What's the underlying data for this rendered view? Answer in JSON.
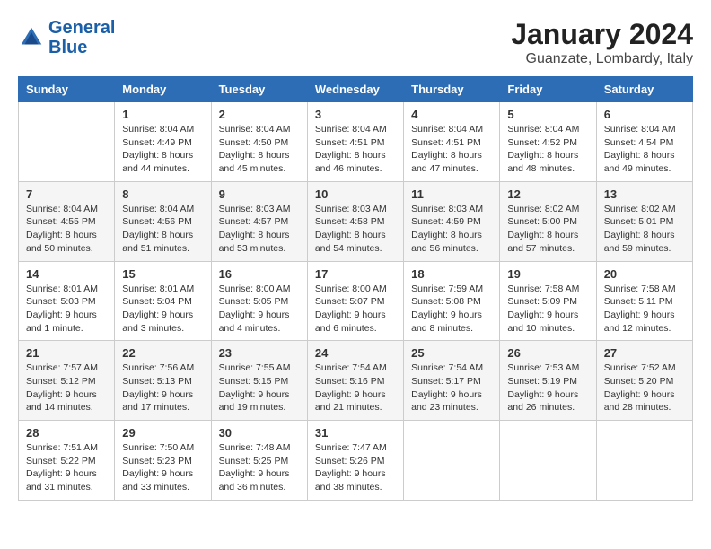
{
  "logo": {
    "line1": "General",
    "line2": "Blue"
  },
  "title": "January 2024",
  "subtitle": "Guanzate, Lombardy, Italy",
  "days_of_week": [
    "Sunday",
    "Monday",
    "Tuesday",
    "Wednesday",
    "Thursday",
    "Friday",
    "Saturday"
  ],
  "weeks": [
    [
      {
        "day": "",
        "info": ""
      },
      {
        "day": "1",
        "info": "Sunrise: 8:04 AM\nSunset: 4:49 PM\nDaylight: 8 hours\nand 44 minutes."
      },
      {
        "day": "2",
        "info": "Sunrise: 8:04 AM\nSunset: 4:50 PM\nDaylight: 8 hours\nand 45 minutes."
      },
      {
        "day": "3",
        "info": "Sunrise: 8:04 AM\nSunset: 4:51 PM\nDaylight: 8 hours\nand 46 minutes."
      },
      {
        "day": "4",
        "info": "Sunrise: 8:04 AM\nSunset: 4:51 PM\nDaylight: 8 hours\nand 47 minutes."
      },
      {
        "day": "5",
        "info": "Sunrise: 8:04 AM\nSunset: 4:52 PM\nDaylight: 8 hours\nand 48 minutes."
      },
      {
        "day": "6",
        "info": "Sunrise: 8:04 AM\nSunset: 4:54 PM\nDaylight: 8 hours\nand 49 minutes."
      }
    ],
    [
      {
        "day": "7",
        "info": "Sunrise: 8:04 AM\nSunset: 4:55 PM\nDaylight: 8 hours\nand 50 minutes."
      },
      {
        "day": "8",
        "info": "Sunrise: 8:04 AM\nSunset: 4:56 PM\nDaylight: 8 hours\nand 51 minutes."
      },
      {
        "day": "9",
        "info": "Sunrise: 8:03 AM\nSunset: 4:57 PM\nDaylight: 8 hours\nand 53 minutes."
      },
      {
        "day": "10",
        "info": "Sunrise: 8:03 AM\nSunset: 4:58 PM\nDaylight: 8 hours\nand 54 minutes."
      },
      {
        "day": "11",
        "info": "Sunrise: 8:03 AM\nSunset: 4:59 PM\nDaylight: 8 hours\nand 56 minutes."
      },
      {
        "day": "12",
        "info": "Sunrise: 8:02 AM\nSunset: 5:00 PM\nDaylight: 8 hours\nand 57 minutes."
      },
      {
        "day": "13",
        "info": "Sunrise: 8:02 AM\nSunset: 5:01 PM\nDaylight: 8 hours\nand 59 minutes."
      }
    ],
    [
      {
        "day": "14",
        "info": "Sunrise: 8:01 AM\nSunset: 5:03 PM\nDaylight: 9 hours\nand 1 minute."
      },
      {
        "day": "15",
        "info": "Sunrise: 8:01 AM\nSunset: 5:04 PM\nDaylight: 9 hours\nand 3 minutes."
      },
      {
        "day": "16",
        "info": "Sunrise: 8:00 AM\nSunset: 5:05 PM\nDaylight: 9 hours\nand 4 minutes."
      },
      {
        "day": "17",
        "info": "Sunrise: 8:00 AM\nSunset: 5:07 PM\nDaylight: 9 hours\nand 6 minutes."
      },
      {
        "day": "18",
        "info": "Sunrise: 7:59 AM\nSunset: 5:08 PM\nDaylight: 9 hours\nand 8 minutes."
      },
      {
        "day": "19",
        "info": "Sunrise: 7:58 AM\nSunset: 5:09 PM\nDaylight: 9 hours\nand 10 minutes."
      },
      {
        "day": "20",
        "info": "Sunrise: 7:58 AM\nSunset: 5:11 PM\nDaylight: 9 hours\nand 12 minutes."
      }
    ],
    [
      {
        "day": "21",
        "info": "Sunrise: 7:57 AM\nSunset: 5:12 PM\nDaylight: 9 hours\nand 14 minutes."
      },
      {
        "day": "22",
        "info": "Sunrise: 7:56 AM\nSunset: 5:13 PM\nDaylight: 9 hours\nand 17 minutes."
      },
      {
        "day": "23",
        "info": "Sunrise: 7:55 AM\nSunset: 5:15 PM\nDaylight: 9 hours\nand 19 minutes."
      },
      {
        "day": "24",
        "info": "Sunrise: 7:54 AM\nSunset: 5:16 PM\nDaylight: 9 hours\nand 21 minutes."
      },
      {
        "day": "25",
        "info": "Sunrise: 7:54 AM\nSunset: 5:17 PM\nDaylight: 9 hours\nand 23 minutes."
      },
      {
        "day": "26",
        "info": "Sunrise: 7:53 AM\nSunset: 5:19 PM\nDaylight: 9 hours\nand 26 minutes."
      },
      {
        "day": "27",
        "info": "Sunrise: 7:52 AM\nSunset: 5:20 PM\nDaylight: 9 hours\nand 28 minutes."
      }
    ],
    [
      {
        "day": "28",
        "info": "Sunrise: 7:51 AM\nSunset: 5:22 PM\nDaylight: 9 hours\nand 31 minutes."
      },
      {
        "day": "29",
        "info": "Sunrise: 7:50 AM\nSunset: 5:23 PM\nDaylight: 9 hours\nand 33 minutes."
      },
      {
        "day": "30",
        "info": "Sunrise: 7:48 AM\nSunset: 5:25 PM\nDaylight: 9 hours\nand 36 minutes."
      },
      {
        "day": "31",
        "info": "Sunrise: 7:47 AM\nSunset: 5:26 PM\nDaylight: 9 hours\nand 38 minutes."
      },
      {
        "day": "",
        "info": ""
      },
      {
        "day": "",
        "info": ""
      },
      {
        "day": "",
        "info": ""
      }
    ]
  ]
}
